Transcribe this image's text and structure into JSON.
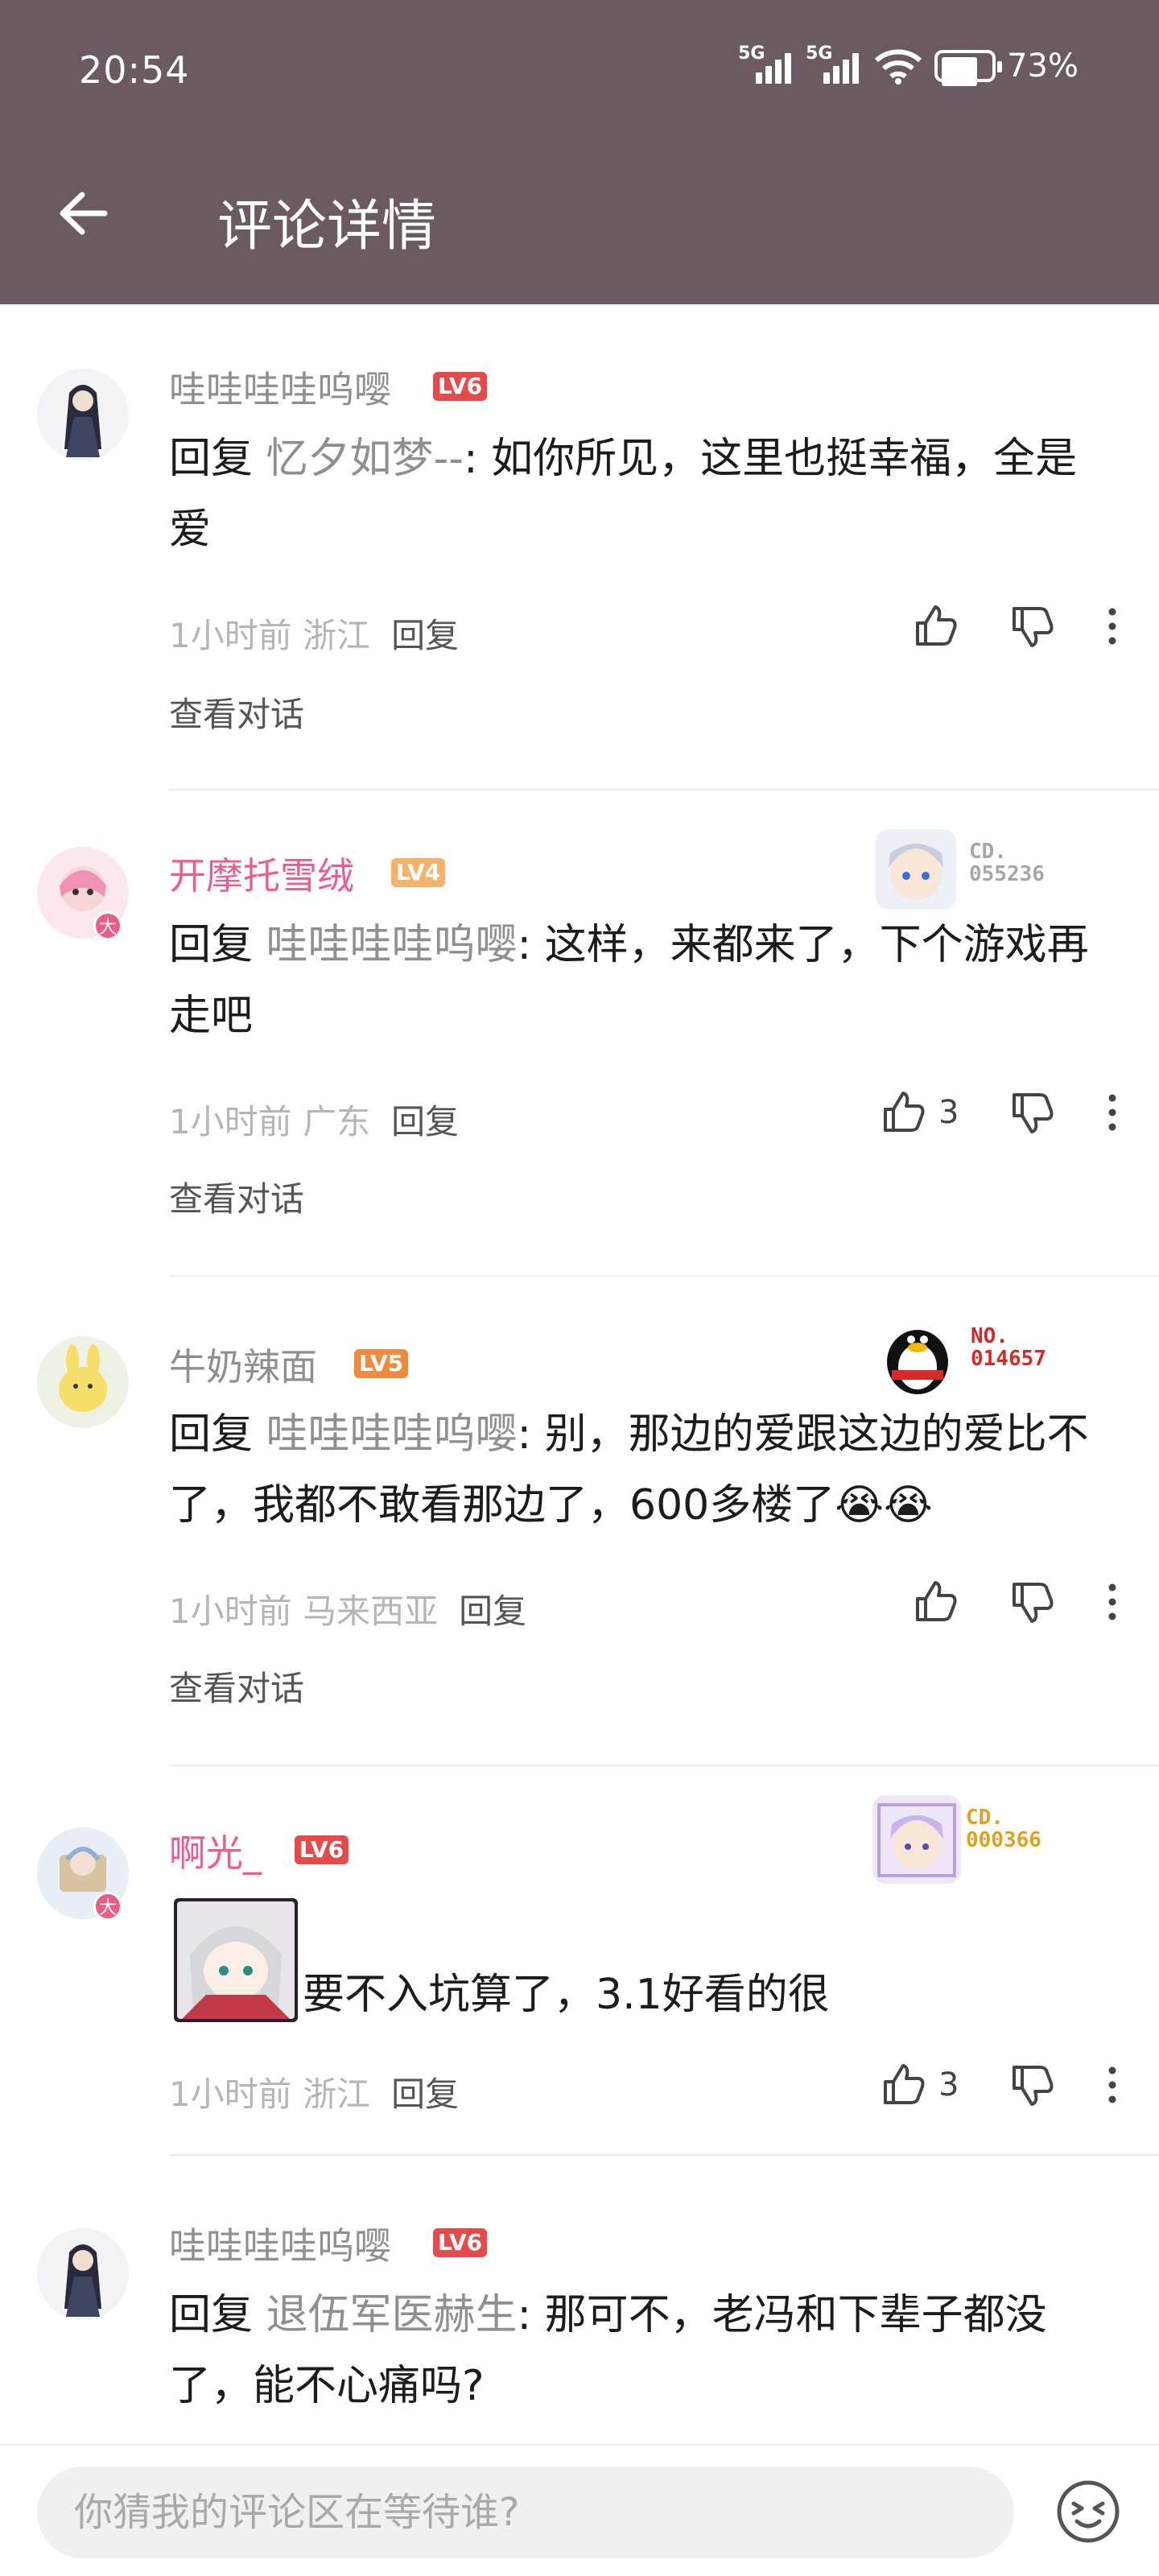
{
  "status_bar": {
    "time": "20:54",
    "network1": "5G",
    "network2": "5G",
    "battery": "73%"
  },
  "header": {
    "title": "评论详情"
  },
  "comments": [
    {
      "username": "哇哇哇哇呜嘤",
      "level": "LV6",
      "reply_prefix": "回复 ",
      "reply_to": "忆夕如梦--",
      "text": ": 如你所见，这里也挺幸福，全是爱",
      "time": "1小时前",
      "location": "浙江",
      "reply_label": "回复",
      "likes": "",
      "view_conversation": "查看对话"
    },
    {
      "username": "开摩托雪绒",
      "level": "LV4",
      "fan_badge": "CD.\n055236",
      "reply_prefix": "回复 ",
      "reply_to": "哇哇哇哇呜嘤",
      "text": ": 这样，来都来了，下个游戏再走吧",
      "time": "1小时前",
      "location": "广东",
      "reply_label": "回复",
      "likes": "3",
      "view_conversation": "查看对话",
      "avatar_badge": "大"
    },
    {
      "username": "牛奶辣面",
      "level": "LV5",
      "fan_badge": "NO.\n014657",
      "reply_prefix": "回复 ",
      "reply_to": "哇哇哇哇呜嘤",
      "text": ": 别，那边的爱跟这边的爱比不了，我都不敢看那边了，600多楼了",
      "emoji": "😭😭",
      "time": "1小时前",
      "location": "马来西亚",
      "reply_label": "回复",
      "likes": "",
      "view_conversation": "查看对话"
    },
    {
      "username": "啊光_",
      "level": "LV6",
      "fan_badge": "CD.\n000366",
      "text": "要不入坑算了，3.1好看的很",
      "time": "1小时前",
      "location": "浙江",
      "reply_label": "回复",
      "likes": "3",
      "avatar_badge": "大"
    },
    {
      "username": "哇哇哇哇呜嘤",
      "level": "LV6",
      "reply_prefix": "回复 ",
      "reply_to": "退伍军医赫生",
      "text": ": 那可不，老冯和下辈子都没了，能不心痛吗?"
    }
  ],
  "composer": {
    "placeholder": "你猜我的评论区在等待谁?"
  },
  "colors": {
    "header": "#6b5964",
    "lv6": "#e64a4a",
    "lv5": "#f08a3c",
    "lv4": "#f6b16a",
    "pink_name": "#ee5b8f"
  }
}
